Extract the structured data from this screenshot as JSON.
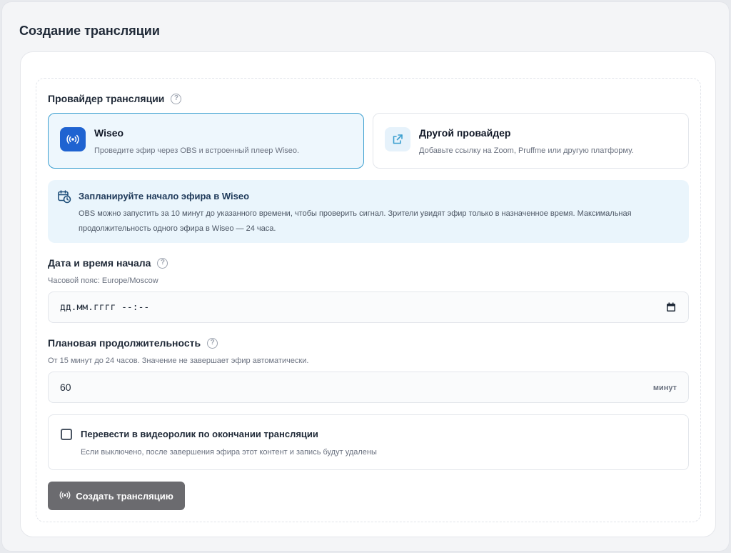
{
  "page": {
    "title": "Создание трансляции"
  },
  "provider": {
    "label": "Провайдер трансляции",
    "options": [
      {
        "title": "Wiseo",
        "description": "Проведите эфир через OBS и встроенный плеер Wiseo.",
        "icon": "broadcast-icon",
        "selected": true
      },
      {
        "title": "Другой провайдер",
        "description": "Добавьте ссылку на Zoom, Pruffme или другую платформу.",
        "icon": "external-link-icon",
        "selected": false
      }
    ]
  },
  "info": {
    "icon": "calendar-clock-icon",
    "title": "Запланируйте начало эфира в Wiseo",
    "text": "OBS можно запустить за 10 минут до указанного времени, чтобы проверить сигнал. Зрители увидят эфир только в назначенное время. Максимальная продолжительность одного эфира в Wiseo — 24 часа."
  },
  "start": {
    "label": "Дата и время начала",
    "hint": "Часовой пояс: Europe/Moscow",
    "placeholder": "дд.мм.гггг --:--"
  },
  "duration": {
    "label": "Плановая продолжительность",
    "hint": "От 15 минут до 24 часов. Значение не завершает эфир автоматически.",
    "value": "60",
    "suffix": "минут"
  },
  "convert": {
    "label": "Перевести в видеоролик по окончании трансляции",
    "description": "Если выключено, после завершения эфира этот контент и запись будут удалены",
    "checked": false
  },
  "submit": {
    "label": "Создать трансляцию",
    "icon": "broadcast-icon"
  },
  "help_glyph": "?",
  "colors": {
    "accent": "#3b9fd0",
    "brand_blue": "#1f63d1",
    "info_bg": "#eaf5fc",
    "button_bg": "#6b6b6f"
  }
}
